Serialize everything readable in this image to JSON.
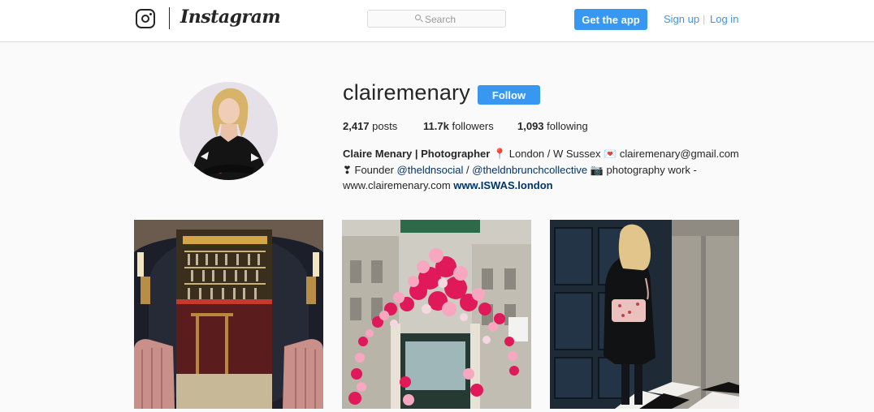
{
  "nav": {
    "wordmark": "Instagram",
    "search_placeholder": "Search",
    "get_app_label": "Get the app",
    "signup_label": "Sign up",
    "separator": "|",
    "login_label": "Log in"
  },
  "profile": {
    "username": "clairemenary",
    "follow_label": "Follow",
    "stats": {
      "posts_count": "2,417",
      "posts_label": "posts",
      "followers_count": "11.7k",
      "followers_label": "followers",
      "following_count": "1,093",
      "following_label": "following"
    },
    "bio": {
      "full_name": "Claire Menary | Photographer",
      "line1_rest": " 📍 London / W Sussex 💌 clairemenary@gmail.com",
      "line2_prefix": "❣ Founder ",
      "mention1": "@theldnsocial",
      "line2_mid": " / ",
      "mention2": "@theldnbrunchcollective",
      "line2_suffix": " 📷 photography work -",
      "line3_text": "www.clairemenary.com ",
      "external_url": "www.ISWAS.london"
    }
  },
  "colors": {
    "accent": "#3897f0",
    "link_dark": "#003569",
    "text": "#262626",
    "border": "#dbdbdb",
    "background": "#fafafa"
  },
  "posts": [
    {
      "subject": "bar-interior"
    },
    {
      "subject": "pink-balloon-arch"
    },
    {
      "subject": "woman-black-coat"
    }
  ]
}
